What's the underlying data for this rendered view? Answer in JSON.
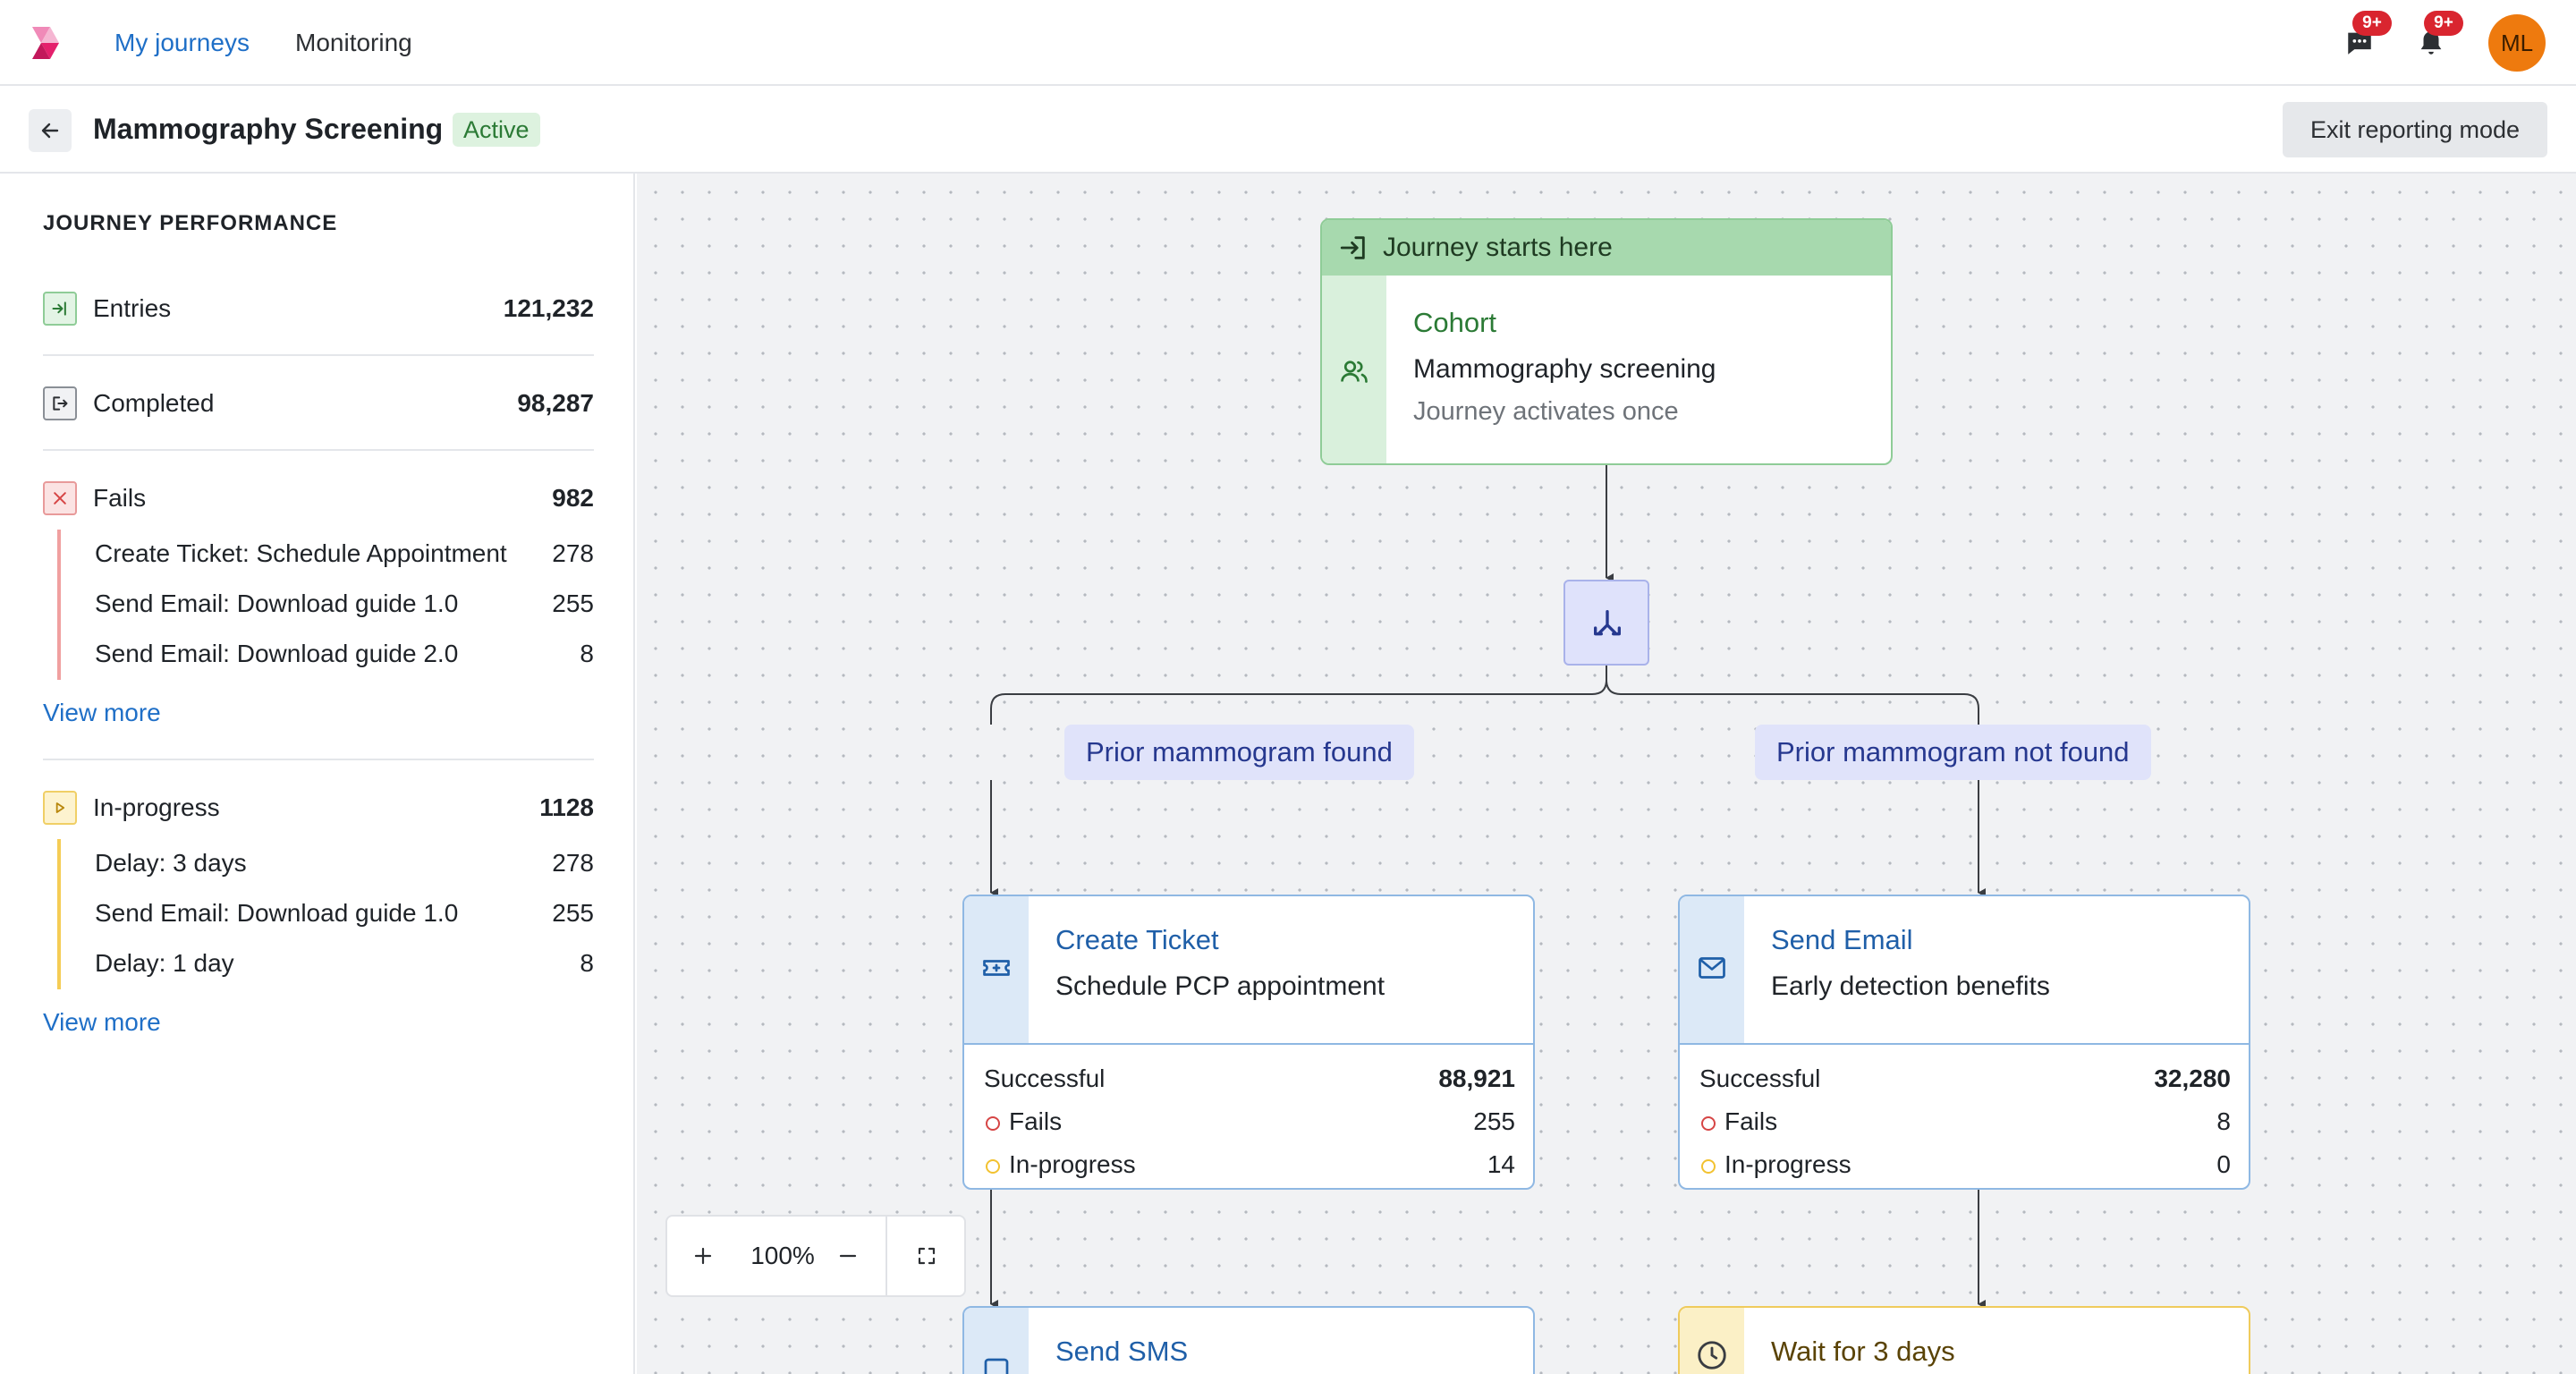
{
  "nav": {
    "items": [
      {
        "label": "My journeys",
        "active": true
      },
      {
        "label": "Monitoring",
        "active": false
      }
    ],
    "messages_badge": "9+",
    "notifications_badge": "9+",
    "avatar_initials": "ML"
  },
  "header": {
    "title": "Mammography Screening",
    "status": "Active",
    "exit_button": "Exit reporting mode"
  },
  "sidebar": {
    "heading": "JOURNEY PERFORMANCE",
    "entries": {
      "label": "Entries",
      "value": "121,232"
    },
    "completed": {
      "label": "Completed",
      "value": "98,287"
    },
    "fails": {
      "label": "Fails",
      "value": "982",
      "items": [
        {
          "label": "Create Ticket: Schedule Appointment",
          "value": "278"
        },
        {
          "label": "Send Email: Download guide 1.0",
          "value": "255"
        },
        {
          "label": "Send Email: Download guide 2.0",
          "value": "8"
        }
      ],
      "view_more": "View more"
    },
    "in_progress": {
      "label": "In-progress",
      "value": "1128",
      "items": [
        {
          "label": "Delay: 3 days",
          "value": "278"
        },
        {
          "label": "Send Email: Download guide 1.0",
          "value": "255"
        },
        {
          "label": "Delay: 1 day",
          "value": "8"
        }
      ],
      "view_more": "View more"
    }
  },
  "canvas": {
    "start": {
      "header": "Journey starts here",
      "type": "Cohort",
      "name": "Mammography screening",
      "note": "Journey activates once"
    },
    "branches": {
      "left": "Prior mammogram found",
      "right": "Prior mammogram not found"
    },
    "left_action": {
      "type": "Create Ticket",
      "name": "Schedule PCP appointment",
      "successful_label": "Successful",
      "successful": "88,921",
      "fails_label": "Fails",
      "fails": "255",
      "in_progress_label": "In-progress",
      "in_progress": "14"
    },
    "right_action": {
      "type": "Send Email",
      "name": "Early detection benefits",
      "successful_label": "Successful",
      "successful": "32,280",
      "fails_label": "Fails",
      "fails": "8",
      "in_progress_label": "In-progress",
      "in_progress": "0"
    },
    "left_next": {
      "type": "Send SMS"
    },
    "right_next": {
      "type": "Wait for 3 days"
    },
    "zoom": "100%"
  },
  "colors": {
    "link": "#1f6fc7",
    "success": "#2b7a35",
    "fail": "#d64545",
    "in_progress": "#f2c230",
    "branch": "#26388f",
    "badge": "#d9252f",
    "avatar": "#ee7a0e"
  },
  "icons": [
    "logo-icon",
    "chat-icon",
    "bell-icon",
    "arrow-left-icon",
    "enter-icon",
    "exit-icon",
    "x-icon",
    "play-icon",
    "users-icon",
    "split-icon",
    "ticket-icon",
    "mail-icon",
    "sms-icon",
    "clock-icon",
    "plus-icon",
    "minus-icon",
    "fullscreen-icon"
  ]
}
